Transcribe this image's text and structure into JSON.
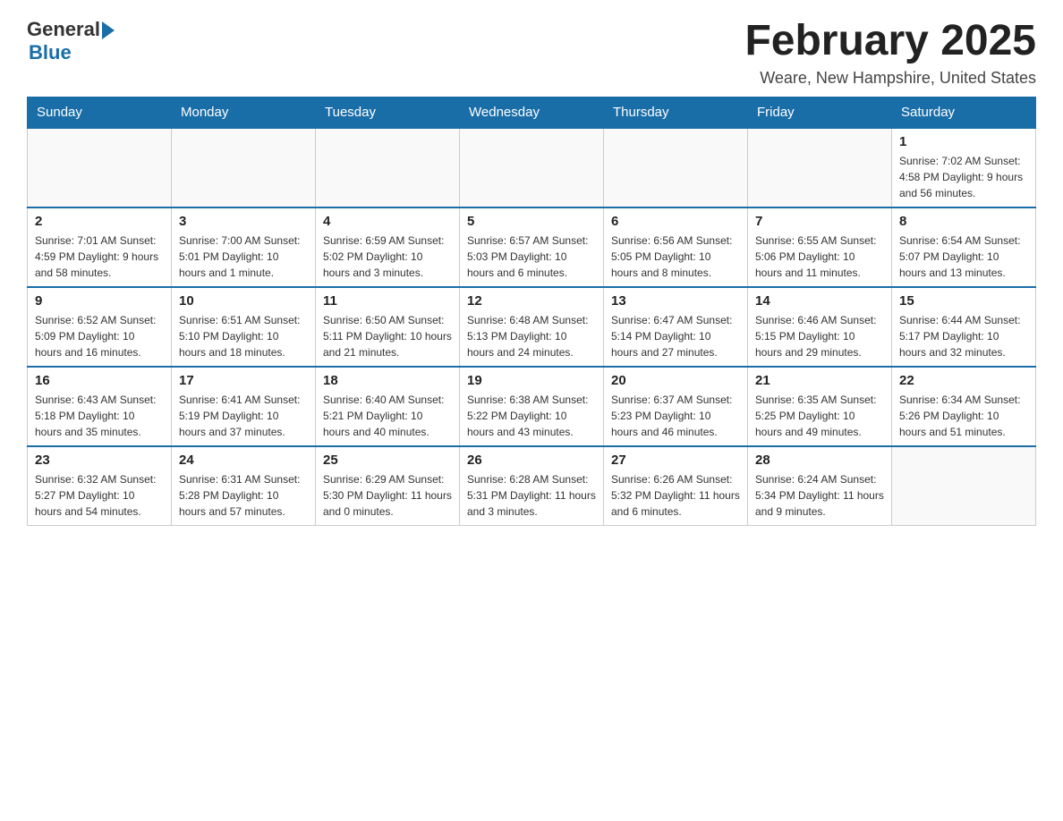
{
  "header": {
    "logo_general": "General",
    "logo_blue": "Blue",
    "month_title": "February 2025",
    "subtitle": "Weare, New Hampshire, United States"
  },
  "days_of_week": [
    "Sunday",
    "Monday",
    "Tuesday",
    "Wednesday",
    "Thursday",
    "Friday",
    "Saturday"
  ],
  "weeks": [
    [
      {
        "day": "",
        "info": ""
      },
      {
        "day": "",
        "info": ""
      },
      {
        "day": "",
        "info": ""
      },
      {
        "day": "",
        "info": ""
      },
      {
        "day": "",
        "info": ""
      },
      {
        "day": "",
        "info": ""
      },
      {
        "day": "1",
        "info": "Sunrise: 7:02 AM\nSunset: 4:58 PM\nDaylight: 9 hours and 56 minutes."
      }
    ],
    [
      {
        "day": "2",
        "info": "Sunrise: 7:01 AM\nSunset: 4:59 PM\nDaylight: 9 hours and 58 minutes."
      },
      {
        "day": "3",
        "info": "Sunrise: 7:00 AM\nSunset: 5:01 PM\nDaylight: 10 hours and 1 minute."
      },
      {
        "day": "4",
        "info": "Sunrise: 6:59 AM\nSunset: 5:02 PM\nDaylight: 10 hours and 3 minutes."
      },
      {
        "day": "5",
        "info": "Sunrise: 6:57 AM\nSunset: 5:03 PM\nDaylight: 10 hours and 6 minutes."
      },
      {
        "day": "6",
        "info": "Sunrise: 6:56 AM\nSunset: 5:05 PM\nDaylight: 10 hours and 8 minutes."
      },
      {
        "day": "7",
        "info": "Sunrise: 6:55 AM\nSunset: 5:06 PM\nDaylight: 10 hours and 11 minutes."
      },
      {
        "day": "8",
        "info": "Sunrise: 6:54 AM\nSunset: 5:07 PM\nDaylight: 10 hours and 13 minutes."
      }
    ],
    [
      {
        "day": "9",
        "info": "Sunrise: 6:52 AM\nSunset: 5:09 PM\nDaylight: 10 hours and 16 minutes."
      },
      {
        "day": "10",
        "info": "Sunrise: 6:51 AM\nSunset: 5:10 PM\nDaylight: 10 hours and 18 minutes."
      },
      {
        "day": "11",
        "info": "Sunrise: 6:50 AM\nSunset: 5:11 PM\nDaylight: 10 hours and 21 minutes."
      },
      {
        "day": "12",
        "info": "Sunrise: 6:48 AM\nSunset: 5:13 PM\nDaylight: 10 hours and 24 minutes."
      },
      {
        "day": "13",
        "info": "Sunrise: 6:47 AM\nSunset: 5:14 PM\nDaylight: 10 hours and 27 minutes."
      },
      {
        "day": "14",
        "info": "Sunrise: 6:46 AM\nSunset: 5:15 PM\nDaylight: 10 hours and 29 minutes."
      },
      {
        "day": "15",
        "info": "Sunrise: 6:44 AM\nSunset: 5:17 PM\nDaylight: 10 hours and 32 minutes."
      }
    ],
    [
      {
        "day": "16",
        "info": "Sunrise: 6:43 AM\nSunset: 5:18 PM\nDaylight: 10 hours and 35 minutes."
      },
      {
        "day": "17",
        "info": "Sunrise: 6:41 AM\nSunset: 5:19 PM\nDaylight: 10 hours and 37 minutes."
      },
      {
        "day": "18",
        "info": "Sunrise: 6:40 AM\nSunset: 5:21 PM\nDaylight: 10 hours and 40 minutes."
      },
      {
        "day": "19",
        "info": "Sunrise: 6:38 AM\nSunset: 5:22 PM\nDaylight: 10 hours and 43 minutes."
      },
      {
        "day": "20",
        "info": "Sunrise: 6:37 AM\nSunset: 5:23 PM\nDaylight: 10 hours and 46 minutes."
      },
      {
        "day": "21",
        "info": "Sunrise: 6:35 AM\nSunset: 5:25 PM\nDaylight: 10 hours and 49 minutes."
      },
      {
        "day": "22",
        "info": "Sunrise: 6:34 AM\nSunset: 5:26 PM\nDaylight: 10 hours and 51 minutes."
      }
    ],
    [
      {
        "day": "23",
        "info": "Sunrise: 6:32 AM\nSunset: 5:27 PM\nDaylight: 10 hours and 54 minutes."
      },
      {
        "day": "24",
        "info": "Sunrise: 6:31 AM\nSunset: 5:28 PM\nDaylight: 10 hours and 57 minutes."
      },
      {
        "day": "25",
        "info": "Sunrise: 6:29 AM\nSunset: 5:30 PM\nDaylight: 11 hours and 0 minutes."
      },
      {
        "day": "26",
        "info": "Sunrise: 6:28 AM\nSunset: 5:31 PM\nDaylight: 11 hours and 3 minutes."
      },
      {
        "day": "27",
        "info": "Sunrise: 6:26 AM\nSunset: 5:32 PM\nDaylight: 11 hours and 6 minutes."
      },
      {
        "day": "28",
        "info": "Sunrise: 6:24 AM\nSunset: 5:34 PM\nDaylight: 11 hours and 9 minutes."
      },
      {
        "day": "",
        "info": ""
      }
    ]
  ]
}
